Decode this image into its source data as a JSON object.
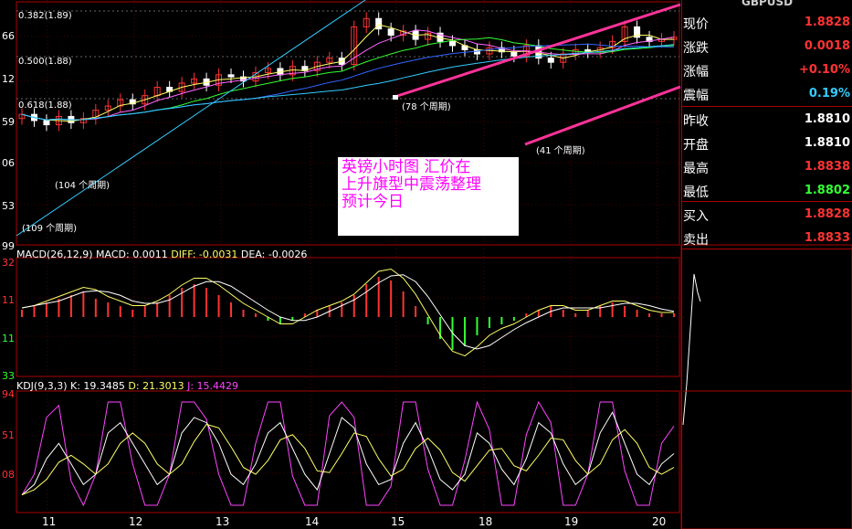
{
  "symbol": "GBPUSD",
  "colors": {
    "up": "#ff3333",
    "down": "#ffffff",
    "green": "#33ff33",
    "cyan": "#33ccff",
    "magenta": "#ff3399"
  },
  "quote_panel": {
    "rows": [
      {
        "label": "现价",
        "value": "1.8828",
        "color": "#ff3333"
      },
      {
        "label": "涨跌",
        "value": "0.0018",
        "color": "#ff3333"
      },
      {
        "label": "涨幅",
        "value": "+0.10%",
        "color": "#ff3333"
      },
      {
        "label": "震幅",
        "value": "0.19%",
        "color": "#33ccff"
      },
      {
        "label": "昨收",
        "value": "1.8810",
        "color": "#ffffff"
      },
      {
        "label": "开盘",
        "value": "1.8810",
        "color": "#ffffff"
      },
      {
        "label": "最高",
        "value": "1.8838",
        "color": "#ff3333"
      },
      {
        "label": "最低",
        "value": "1.8802",
        "color": "#33ff33"
      },
      {
        "label": "买入",
        "value": "1.8828",
        "color": "#ff3333"
      },
      {
        "label": "卖出",
        "value": "1.8833",
        "color": "#ff3333"
      }
    ]
  },
  "chart_data": [
    {
      "type": "candlestick",
      "title": "",
      "y_tick_labels": [
        "66",
        "12",
        "59",
        "06",
        "53",
        "99"
      ],
      "x_tick_labels": [
        "11",
        "12",
        "13",
        "14",
        "15",
        "18",
        "19",
        "20"
      ],
      "fib_levels": [
        {
          "label": "0.382(1.89)"
        },
        {
          "label": "0.500(1.88)"
        },
        {
          "label": "0.618(1.88)"
        }
      ],
      "period_labels": [
        "(104 个周期)",
        "(109 个周期)",
        "(78 个周期)",
        "(41 个周期)"
      ],
      "annotation": "英镑小时图 汇价在上升旗型中震荡整理预计今日",
      "note_lines": [
        "英镑小时图  汇价在",
        "上升旗型中震荡整理",
        "预计今日"
      ],
      "close_path": [
        53,
        50,
        48,
        52,
        49,
        51,
        55,
        57,
        60,
        58,
        62,
        66,
        64,
        68,
        70,
        67,
        72,
        71,
        69,
        73,
        75,
        72,
        76,
        74,
        78,
        80,
        77,
        95,
        99,
        94,
        91,
        93,
        89,
        92,
        88,
        86,
        84,
        82,
        85,
        83,
        81,
        86,
        80,
        78,
        82,
        84,
        83,
        85,
        88,
        95,
        90,
        88,
        89,
        90
      ]
    },
    {
      "type": "macd",
      "header": "MACD(26,12,9)",
      "values_text": {
        "macd": "MACD: 0.0011",
        "diff": "DIFF: -0.0031",
        "dea": "DEA: -0.0026"
      },
      "y_tick_labels": [
        "32",
        "11",
        "11",
        "33"
      ],
      "hist": [
        2,
        3,
        4,
        5,
        6,
        7,
        5,
        4,
        3,
        2,
        3,
        4,
        6,
        8,
        9,
        8,
        6,
        4,
        2,
        1,
        -1,
        -2,
        -1,
        1,
        2,
        3,
        4,
        6,
        9,
        11,
        10,
        7,
        3,
        -2,
        -6,
        -9,
        -8,
        -5,
        -3,
        -2,
        -1,
        1,
        2,
        3,
        2,
        1,
        2,
        3,
        4,
        3,
        2,
        1,
        1,
        1
      ]
    },
    {
      "type": "kdj",
      "header": "KDJ(9,3,3)",
      "values_text": {
        "k": "K: 19.3485",
        "d": "D: 21.3013",
        "j": "J: 15.4429"
      },
      "y_tick_labels": [
        "94",
        "51",
        "08"
      ],
      "k_path": [
        10,
        20,
        45,
        60,
        40,
        20,
        30,
        70,
        80,
        60,
        40,
        20,
        30,
        70,
        85,
        80,
        60,
        30,
        20,
        40,
        70,
        80,
        55,
        30,
        15,
        50,
        85,
        75,
        40,
        20,
        25,
        60,
        80,
        55,
        25,
        15,
        30,
        70,
        60,
        35,
        20,
        45,
        80,
        70,
        40,
        20,
        30,
        70,
        90,
        60,
        30,
        20,
        40,
        50
      ]
    }
  ]
}
